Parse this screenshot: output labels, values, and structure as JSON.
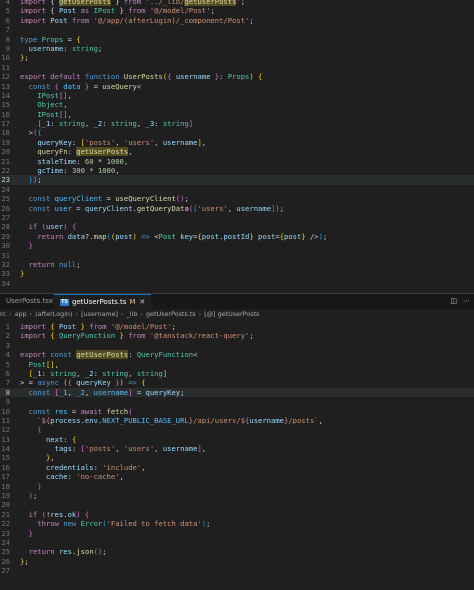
{
  "editor_top": {
    "lines": [
      {
        "n": "4",
        "html": "<span class=\"ctl\">import</span> { <span class=\"var hl\">getUserPosts</span> } <span class=\"ctl\">from</span> <span class=\"str\">'../_lib/<span class=\"hl\">getUserPosts</span>'</span>;"
      },
      {
        "n": "5",
        "html": "<span class=\"ctl\">import</span> { <span class=\"var\">Post</span> <span class=\"ctl\">as</span> <span class=\"ty\">IPost</span> } <span class=\"ctl\">from</span> <span class=\"str\">'@/model/Post'</span>;"
      },
      {
        "n": "6",
        "html": "<span class=\"ctl\">import</span> <span class=\"var\">Post</span> <span class=\"ctl\">from</span> <span class=\"str\">'@/app/(afterLogin)/_component/Post'</span>;"
      },
      {
        "n": "7",
        "html": ""
      },
      {
        "n": "8",
        "html": "<span class=\"kw\">type</span> <span class=\"ty\">Props</span> = <span class=\"br1\">{</span>"
      },
      {
        "n": "9",
        "html": "  <span class=\"var\">username</span>: <span class=\"ty\">string</span>;"
      },
      {
        "n": "10",
        "html": "<span class=\"br1\">}</span>;"
      },
      {
        "n": "11",
        "html": ""
      },
      {
        "n": "12",
        "html": "<span class=\"ctl\">export</span> <span class=\"ctl\">default</span> <span class=\"kw\">function</span> <span class=\"fn\">UserPosts</span><span class=\"br1\">(</span><span class=\"br2\">{</span> <span class=\"var\">username</span> <span class=\"br2\">}</span>: <span class=\"ty\">Props</span><span class=\"br1\">)</span> <span class=\"br1\">{</span>"
      },
      {
        "n": "13",
        "html": "  <span class=\"kw\">const</span> <span class=\"br2\">{</span> <span class=\"const\">data</span> <span class=\"br2\">}</span> = <span class=\"fn\">useQuery</span>&lt;"
      },
      {
        "n": "14",
        "html": "    <span class=\"ty\">IPost</span><span class=\"br2\">[]</span>,"
      },
      {
        "n": "15",
        "html": "    <span class=\"ty\">Object</span>,"
      },
      {
        "n": "16",
        "html": "    <span class=\"ty\">IPost</span><span class=\"br2\">[]</span>,"
      },
      {
        "n": "17",
        "html": "    <span class=\"br2\">[</span><span class=\"var\">_1</span>: <span class=\"ty\">string</span>, <span class=\"var\">_2</span>: <span class=\"ty\">string</span>, <span class=\"var\">_3</span>: <span class=\"ty\">string</span><span class=\"br2\">]</span>"
      },
      {
        "n": "18",
        "html": "  &gt;<span class=\"br2\">(</span><span class=\"br3\">{</span>"
      },
      {
        "n": "19",
        "html": "    <span class=\"var\">queryKey</span>: <span class=\"br1\">[</span><span class=\"str\">'posts'</span>, <span class=\"str\">'users'</span>, <span class=\"var\">username</span><span class=\"br1\">]</span>,"
      },
      {
        "n": "20",
        "html": "    <span class=\"fn\">queryFn</span>: <span class=\"var hl\">getUserPosts</span>,"
      },
      {
        "n": "21",
        "html": "    <span class=\"var\">staleTime</span>: <span class=\"num\">60</span> * <span class=\"num\">1000</span>,"
      },
      {
        "n": "22",
        "html": "    <span class=\"var\">gcTime</span>: <span class=\"num\">300</span> * <span class=\"num\">1000</span>,"
      },
      {
        "n": "23",
        "html": "  <span class=\"br3\">}</span><span class=\"br2\">)</span>;",
        "active": true
      },
      {
        "n": "24",
        "html": ""
      },
      {
        "n": "25",
        "html": "  <span class=\"kw\">const</span> <span class=\"const\">queryClient</span> = <span class=\"fn\">useQueryClient</span><span class=\"br2\">()</span>;"
      },
      {
        "n": "26",
        "html": "  <span class=\"kw\">const</span> <span class=\"const\">user</span> = <span class=\"var\">queryClient</span>.<span class=\"fn\">getQueryData</span><span class=\"br2\">(</span><span class=\"br3\">[</span><span class=\"str\">'users'</span>, <span class=\"var\">username</span><span class=\"br3\">]</span><span class=\"br2\">)</span>;"
      },
      {
        "n": "27",
        "html": ""
      },
      {
        "n": "28",
        "html": "  <span class=\"ctl\">if</span> <span class=\"br2\">(</span><span class=\"var\">user</span><span class=\"br2\">)</span> <span class=\"br2\">{</span>"
      },
      {
        "n": "29",
        "html": "    <span class=\"ctl\">return</span> <span class=\"var\">data</span>?.<span class=\"fn\">map</span><span class=\"br3\">(</span><span class=\"br1\">(</span><span class=\"var\">post</span><span class=\"br1\">)</span> <span class=\"kw\">=&gt;</span> &lt;<span class=\"ty\">Post</span> <span class=\"var\">key</span>=<span class=\"br1\">{</span><span class=\"var\">post</span>.<span class=\"var\">postId</span><span class=\"br1\">}</span> <span class=\"var\">post</span>=<span class=\"br1\">{</span><span class=\"var\">post</span><span class=\"br1\">}</span> /&gt;<span class=\"br3\">)</span>;"
      },
      {
        "n": "30",
        "html": "  <span class=\"br2\">}</span>"
      },
      {
        "n": "31",
        "html": ""
      },
      {
        "n": "32",
        "html": "  <span class=\"ctl\">return</span> <span class=\"kw\">null</span>;"
      },
      {
        "n": "33",
        "html": "<span class=\"br1\">}</span>"
      },
      {
        "n": "34",
        "html": ""
      }
    ]
  },
  "tabs": [
    {
      "label": "UserPosts.tsx",
      "active": false,
      "icon": "tsx-icon"
    },
    {
      "label": "getUserPosts.ts",
      "active": true,
      "modified": "M",
      "icon": "ts-icon"
    }
  ],
  "tab_actions": [
    "split-editor-icon",
    "more-actions-icon"
  ],
  "breadcrumb": [
    "rc",
    "app",
    "(afterLogin)",
    "[username]",
    "_lib",
    "getUserPosts.ts",
    "[@] getUserPosts"
  ],
  "editor_bottom": {
    "lines": [
      {
        "n": "1",
        "html": "<span class=\"ctl\">import</span> <span class=\"br1\">{</span> <span class=\"var\">Post</span> <span class=\"br1\">}</span> <span class=\"ctl\">from</span> <span class=\"str\">'@/model/Post'</span>;"
      },
      {
        "n": "2",
        "html": "<span class=\"ctl\">import</span> <span class=\"br1\">{</span> <span class=\"ty\">QueryFunction</span> <span class=\"br1\">}</span> <span class=\"ctl\">from</span> <span class=\"str\">'@tanstack/react-query'</span>;"
      },
      {
        "n": "3",
        "html": ""
      },
      {
        "n": "4",
        "html": "<span class=\"ctl\">export</span> <span class=\"kw\">const</span> <span class=\"fn hl\">getUserPosts</span>: <span class=\"ty\">QueryFunction</span>&lt;"
      },
      {
        "n": "5",
        "html": "  <span class=\"ty\">Post</span><span class=\"br1\">[]</span>,"
      },
      {
        "n": "6",
        "html": "  <span class=\"br1\">[</span><span class=\"var\">_1</span>: <span class=\"ty\">string</span>, <span class=\"var\">_2</span>: <span class=\"ty\">string</span>, <span class=\"ty\">string</span><span class=\"br1\">]</span>"
      },
      {
        "n": "7",
        "html": "&gt; = <span class=\"kw\">async</span> <span class=\"br1\">(</span><span class=\"br2\">{</span> <span class=\"var\">queryKey</span> <span class=\"br2\">}</span><span class=\"br1\">)</span> <span class=\"kw\">=&gt;</span> <span class=\"br1\">{</span>"
      },
      {
        "n": "8",
        "html": "  <span class=\"kw\">const</span> <span class=\"br2\">[</span><span class=\"const\">_1</span>, <span class=\"const\">_2</span>, <span class=\"const\">username</span><span class=\"br2\">]</span> = <span class=\"var\">queryKey</span>;",
        "active": true
      },
      {
        "n": "9",
        "html": ""
      },
      {
        "n": "10",
        "html": "  <span class=\"kw\">const</span> <span class=\"const\">res</span> = <span class=\"ctl\">await</span> <span class=\"fn\">fetch</span><span class=\"br2\">(</span>"
      },
      {
        "n": "11",
        "html": "    <span class=\"str\">`${</span><span class=\"var\">process</span>.<span class=\"var\">env</span>.<span class=\"const\">NEXT_PUBLIC_BASE_URL</span><span class=\"str\">}/api/users/${</span><span class=\"var\">username</span><span class=\"str\">}/posts`</span>,"
      },
      {
        "n": "12",
        "html": "    <span class=\"br3\">{</span>"
      },
      {
        "n": "13",
        "html": "      <span class=\"var\">next</span>: <span class=\"br1\">{</span>"
      },
      {
        "n": "14",
        "html": "        <span class=\"var\">tags</span>: <span class=\"br2\">[</span><span class=\"str\">'posts'</span>, <span class=\"str\">'users'</span>, <span class=\"var\">username</span><span class=\"br2\">]</span>,"
      },
      {
        "n": "15",
        "html": "      <span class=\"br1\">}</span>,"
      },
      {
        "n": "16",
        "html": "      <span class=\"var\">credentials</span>: <span class=\"str\">'include'</span>,"
      },
      {
        "n": "17",
        "html": "      <span class=\"var\">cache</span>: <span class=\"str\">'no-cache'</span>,"
      },
      {
        "n": "18",
        "html": "    <span class=\"br3\">}</span>"
      },
      {
        "n": "19",
        "html": "  <span class=\"br2\">)</span>;"
      },
      {
        "n": "20",
        "html": ""
      },
      {
        "n": "21",
        "html": "  <span class=\"ctl\">if</span> <span class=\"br2\">(</span>!<span class=\"var\">res</span>.<span class=\"var\">ok</span><span class=\"br2\">)</span> <span class=\"br2\">{</span>"
      },
      {
        "n": "22",
        "html": "    <span class=\"ctl\">throw</span> <span class=\"kw\">new</span> <span class=\"ty\">Error</span><span class=\"br3\">(</span><span class=\"str\">'Failed to fetch data'</span><span class=\"br3\">)</span>;"
      },
      {
        "n": "23",
        "html": "  <span class=\"br2\">}</span>"
      },
      {
        "n": "24",
        "html": ""
      },
      {
        "n": "25",
        "html": "  <span class=\"ctl\">return</span> <span class=\"var\">res</span>.<span class=\"fn\">json</span><span class=\"br2\">()</span>;"
      },
      {
        "n": "26",
        "html": "<span class=\"br1\">}</span>;"
      },
      {
        "n": "27",
        "html": ""
      }
    ]
  }
}
